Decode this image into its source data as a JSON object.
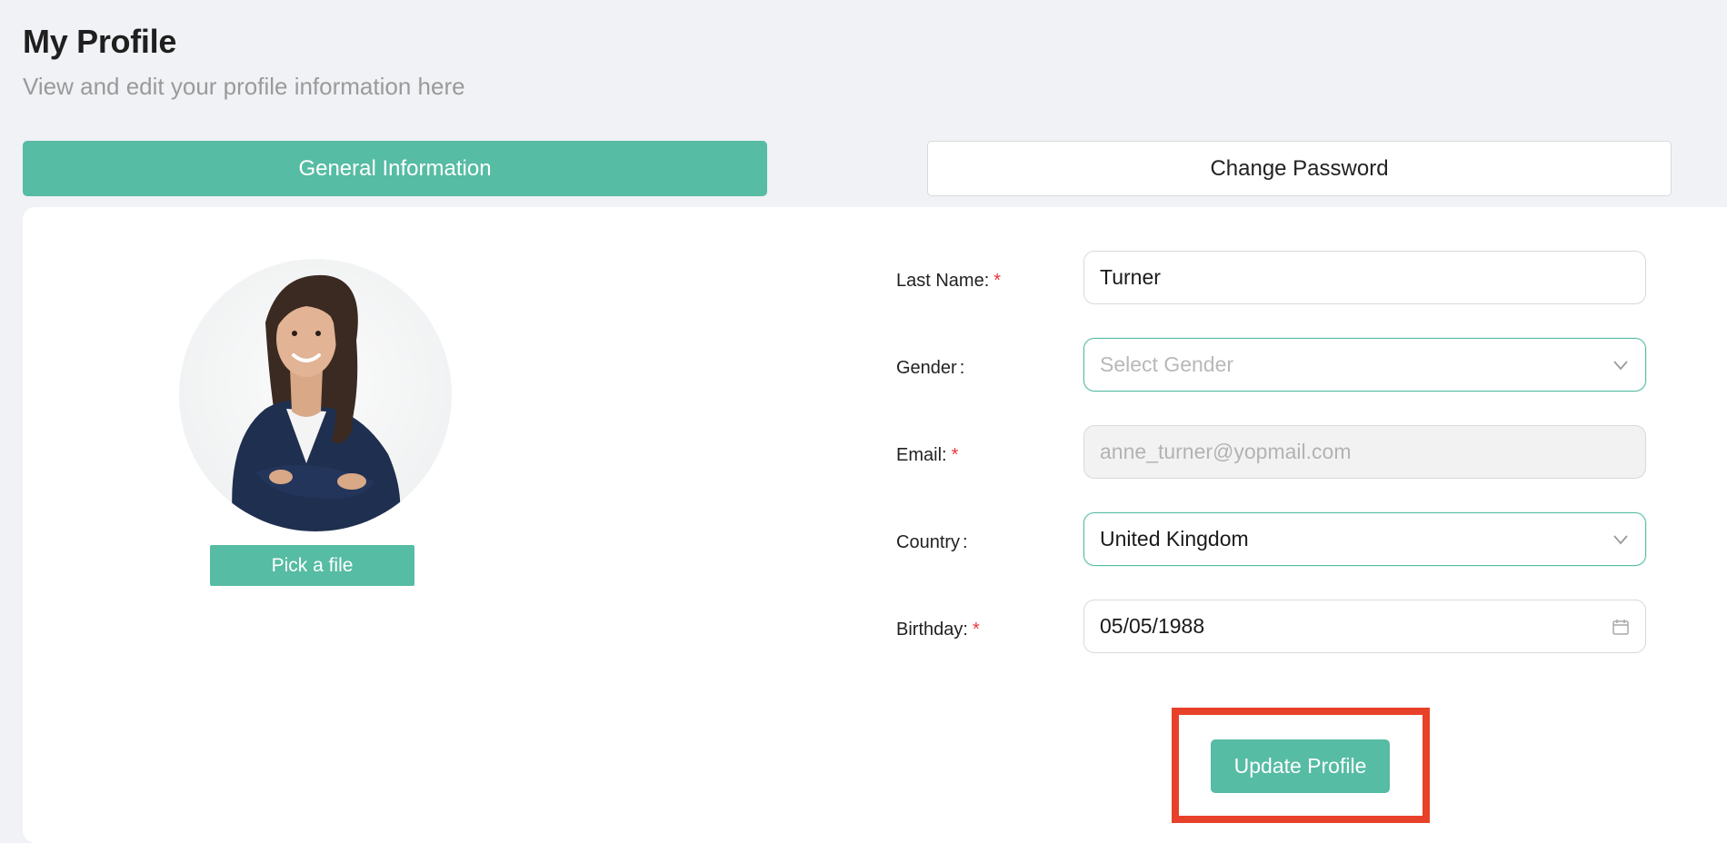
{
  "header": {
    "title": "My Profile",
    "subtitle": "View and edit your profile information here"
  },
  "tabs": [
    {
      "label": "General Information",
      "active": true
    },
    {
      "label": "Change Password",
      "active": false
    }
  ],
  "avatar": {
    "pick_file_label": "Pick a file"
  },
  "form": {
    "last_name": {
      "label": "Last Name:",
      "value": "Turner",
      "required": true
    },
    "gender": {
      "label": "Gender",
      "placeholder": "Select Gender",
      "value": "",
      "icon": "chevron-down-icon"
    },
    "email": {
      "label": "Email:",
      "value": "anne_turner@yopmail.com",
      "required": true,
      "disabled": true
    },
    "country": {
      "label": "Country",
      "value": "United Kingdom",
      "icon": "chevron-down-icon"
    },
    "birthday": {
      "label": "Birthday:",
      "value": "05/05/1988",
      "required": true,
      "icon": "calendar-icon"
    },
    "required_marker": "*",
    "colon": ":"
  },
  "actions": {
    "update_label": "Update Profile"
  },
  "colors": {
    "accent": "#56bca4",
    "highlight": "#e8412a",
    "required": "#e5383b"
  }
}
